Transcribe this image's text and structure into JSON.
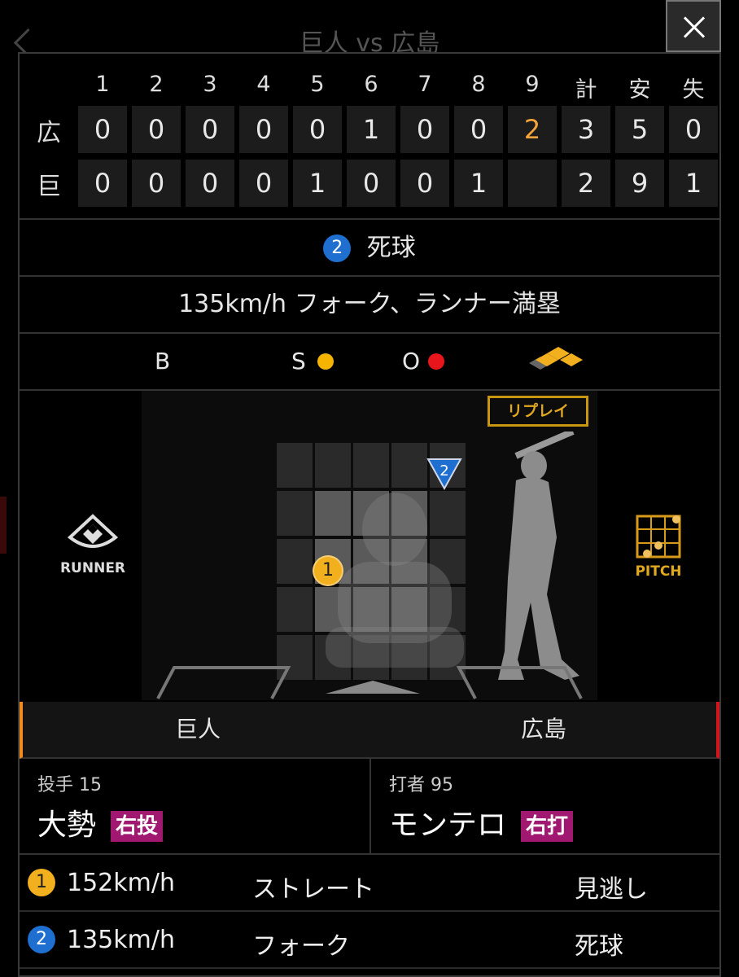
{
  "header": {
    "title": "巨人 vs 広島"
  },
  "scoreboard": {
    "columns": [
      "1",
      "2",
      "3",
      "4",
      "5",
      "6",
      "7",
      "8",
      "9",
      "計",
      "安",
      "失"
    ],
    "rows": [
      {
        "team": "広",
        "cells": [
          "0",
          "0",
          "0",
          "0",
          "0",
          "1",
          "0",
          "0",
          "2",
          "3",
          "5",
          "0"
        ]
      },
      {
        "team": "巨",
        "cells": [
          "0",
          "0",
          "0",
          "0",
          "1",
          "0",
          "0",
          "1",
          "",
          "2",
          "9",
          "1"
        ]
      }
    ],
    "highlight_color": "#f4a43a"
  },
  "event": {
    "number": "2",
    "label": "死球"
  },
  "description": "135km/h フォーク、ランナー満塁",
  "count": {
    "b": "B",
    "s": "S",
    "o": "O",
    "s_color": "#f5b400",
    "o_color": "#e8161c"
  },
  "field": {
    "replay_label": "リプレイ",
    "runner_label": "RUNNER",
    "pitch_label": "PITCH",
    "pitch_markers": [
      {
        "n": "1",
        "color": "#f2b01e",
        "shape": "circle"
      },
      {
        "n": "2",
        "color": "#1f6fd1",
        "shape": "triangle"
      }
    ]
  },
  "teams": {
    "left": {
      "name": "巨人",
      "accent": "#f08a1c",
      "role": "投手 15",
      "player": "大勢",
      "tag": "右投"
    },
    "right": {
      "name": "広島",
      "accent": "#d2141e",
      "role": "打者 95",
      "player": "モンテロ",
      "tag": "右打"
    }
  },
  "pitches": [
    {
      "n": "1",
      "speed": "152km/h",
      "type": "ストレート",
      "result": "見逃し"
    },
    {
      "n": "2",
      "speed": "135km/h",
      "type": "フォーク",
      "result": "死球"
    }
  ]
}
